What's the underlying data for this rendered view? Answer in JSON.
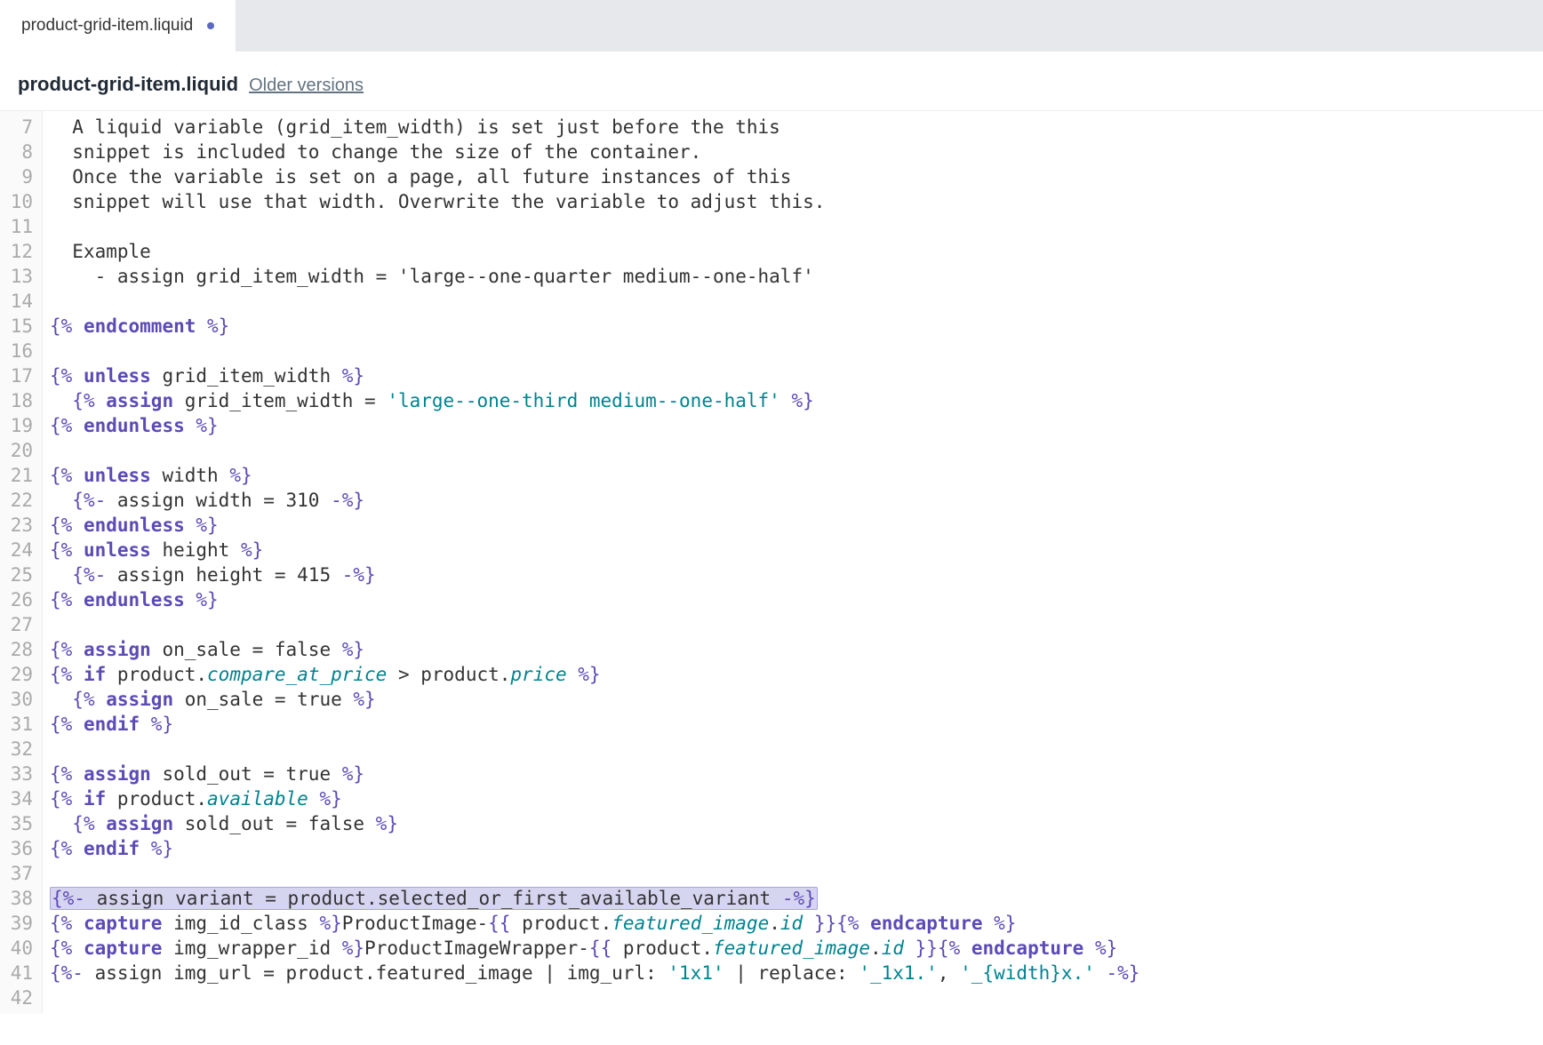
{
  "tab": {
    "label": "product-grid-item.liquid"
  },
  "header": {
    "title": "product-grid-item.liquid",
    "older_versions": "Older versions"
  },
  "gutter": {
    "start": 7,
    "end": 42
  },
  "lines": [
    {
      "n": 7,
      "segs": [
        [
          "  A liquid variable (grid_item_width) is set just before the this",
          ""
        ]
      ]
    },
    {
      "n": 8,
      "segs": [
        [
          "  snippet is included to change the size of the container.",
          ""
        ]
      ]
    },
    {
      "n": 9,
      "segs": [
        [
          "  Once the variable is set on a page, all future instances of this",
          ""
        ]
      ]
    },
    {
      "n": 10,
      "segs": [
        [
          "  snippet will use that width. Overwrite the variable to adjust this.",
          ""
        ]
      ]
    },
    {
      "n": 11,
      "segs": []
    },
    {
      "n": 12,
      "segs": [
        [
          "  Example",
          ""
        ]
      ]
    },
    {
      "n": 13,
      "segs": [
        [
          "    - assign grid_item_width = 'large--one-quarter medium--one-half'",
          ""
        ]
      ]
    },
    {
      "n": 14,
      "segs": []
    },
    {
      "n": 15,
      "segs": [
        [
          "{% ",
          "tagc"
        ],
        [
          "endcomment",
          "kw"
        ],
        [
          " %}",
          "tagc"
        ]
      ]
    },
    {
      "n": 16,
      "segs": []
    },
    {
      "n": 17,
      "segs": [
        [
          "{% ",
          "tagc"
        ],
        [
          "unless",
          "kw"
        ],
        [
          " grid_item_width ",
          ""
        ],
        [
          "%}",
          "tagc"
        ]
      ]
    },
    {
      "n": 18,
      "segs": [
        [
          "  ",
          ""
        ],
        [
          "{% ",
          "tagc"
        ],
        [
          "assign",
          "kw"
        ],
        [
          " grid_item_width = ",
          ""
        ],
        [
          "'large--one-third medium--one-half'",
          "str"
        ],
        [
          " %}",
          "tagc"
        ]
      ]
    },
    {
      "n": 19,
      "segs": [
        [
          "{% ",
          "tagc"
        ],
        [
          "endunless",
          "kw"
        ],
        [
          " %}",
          "tagc"
        ]
      ]
    },
    {
      "n": 20,
      "segs": []
    },
    {
      "n": 21,
      "segs": [
        [
          "{% ",
          "tagc"
        ],
        [
          "unless",
          "kw"
        ],
        [
          " width ",
          ""
        ],
        [
          "%}",
          "tagc"
        ]
      ]
    },
    {
      "n": 22,
      "segs": [
        [
          "  ",
          ""
        ],
        [
          "{%-",
          "tagc"
        ],
        [
          " assign width = 310 ",
          ""
        ],
        [
          "-%}",
          "tagc"
        ]
      ]
    },
    {
      "n": 23,
      "segs": [
        [
          "{% ",
          "tagc"
        ],
        [
          "endunless",
          "kw"
        ],
        [
          " %}",
          "tagc"
        ]
      ]
    },
    {
      "n": 24,
      "segs": [
        [
          "{% ",
          "tagc"
        ],
        [
          "unless",
          "kw"
        ],
        [
          " height ",
          ""
        ],
        [
          "%}",
          "tagc"
        ]
      ]
    },
    {
      "n": 25,
      "segs": [
        [
          "  ",
          ""
        ],
        [
          "{%-",
          "tagc"
        ],
        [
          " assign height = 415 ",
          ""
        ],
        [
          "-%}",
          "tagc"
        ]
      ]
    },
    {
      "n": 26,
      "segs": [
        [
          "{% ",
          "tagc"
        ],
        [
          "endunless",
          "kw"
        ],
        [
          " %}",
          "tagc"
        ]
      ]
    },
    {
      "n": 27,
      "segs": []
    },
    {
      "n": 28,
      "segs": [
        [
          "{% ",
          "tagc"
        ],
        [
          "assign",
          "kw"
        ],
        [
          " on_sale = false ",
          ""
        ],
        [
          "%}",
          "tagc"
        ]
      ]
    },
    {
      "n": 29,
      "segs": [
        [
          "{% ",
          "tagc"
        ],
        [
          "if",
          "kw"
        ],
        [
          " product.",
          ""
        ],
        [
          "compare_at_price",
          "prop"
        ],
        [
          " > product.",
          ""
        ],
        [
          "price",
          "prop"
        ],
        [
          " %}",
          "tagc"
        ]
      ]
    },
    {
      "n": 30,
      "segs": [
        [
          "  ",
          ""
        ],
        [
          "{% ",
          "tagc"
        ],
        [
          "assign",
          "kw"
        ],
        [
          " on_sale = true ",
          ""
        ],
        [
          "%}",
          "tagc"
        ]
      ]
    },
    {
      "n": 31,
      "segs": [
        [
          "{% ",
          "tagc"
        ],
        [
          "endif",
          "kw"
        ],
        [
          " %}",
          "tagc"
        ]
      ]
    },
    {
      "n": 32,
      "segs": []
    },
    {
      "n": 33,
      "segs": [
        [
          "{% ",
          "tagc"
        ],
        [
          "assign",
          "kw"
        ],
        [
          " sold_out = true ",
          ""
        ],
        [
          "%}",
          "tagc"
        ]
      ]
    },
    {
      "n": 34,
      "segs": [
        [
          "{% ",
          "tagc"
        ],
        [
          "if",
          "kw"
        ],
        [
          " product.",
          ""
        ],
        [
          "available",
          "prop"
        ],
        [
          " %}",
          "tagc"
        ]
      ]
    },
    {
      "n": 35,
      "segs": [
        [
          "  ",
          ""
        ],
        [
          "{% ",
          "tagc"
        ],
        [
          "assign",
          "kw"
        ],
        [
          " sold_out = false ",
          ""
        ],
        [
          "%}",
          "tagc"
        ]
      ]
    },
    {
      "n": 36,
      "segs": [
        [
          "{% ",
          "tagc"
        ],
        [
          "endif",
          "kw"
        ],
        [
          " %}",
          "tagc"
        ]
      ]
    },
    {
      "n": 37,
      "segs": []
    },
    {
      "n": 38,
      "hl": true,
      "segs": [
        [
          "{%-",
          "tagc"
        ],
        [
          " assign variant = product.selected_or_first_available_variant ",
          ""
        ],
        [
          "-%}",
          "tagc"
        ]
      ]
    },
    {
      "n": 39,
      "segs": [
        [
          "{% ",
          "tagc"
        ],
        [
          "capture",
          "kw"
        ],
        [
          " img_id_class ",
          ""
        ],
        [
          "%}",
          "tagc"
        ],
        [
          "ProductImage-",
          ""
        ],
        [
          "{{",
          "tagc"
        ],
        [
          " product.",
          ""
        ],
        [
          "featured_image",
          "prop"
        ],
        [
          ".",
          ""
        ],
        [
          "id",
          "prop"
        ],
        [
          " }}",
          "tagc"
        ],
        [
          "{% ",
          "tagc"
        ],
        [
          "endcapture",
          "kw"
        ],
        [
          " %}",
          "tagc"
        ]
      ]
    },
    {
      "n": 40,
      "segs": [
        [
          "{% ",
          "tagc"
        ],
        [
          "capture",
          "kw"
        ],
        [
          " img_wrapper_id ",
          ""
        ],
        [
          "%}",
          "tagc"
        ],
        [
          "ProductImageWrapper-",
          ""
        ],
        [
          "{{",
          "tagc"
        ],
        [
          " product.",
          ""
        ],
        [
          "featured_image",
          "prop"
        ],
        [
          ".",
          ""
        ],
        [
          "id",
          "prop"
        ],
        [
          " }}",
          "tagc"
        ],
        [
          "{% ",
          "tagc"
        ],
        [
          "endcapture",
          "kw"
        ],
        [
          " %}",
          "tagc"
        ]
      ]
    },
    {
      "n": 41,
      "segs": [
        [
          "{%-",
          "tagc"
        ],
        [
          " assign img_url = product.featured_image | img_url: ",
          ""
        ],
        [
          "'1x1'",
          "str"
        ],
        [
          " | replace: ",
          ""
        ],
        [
          "'_1x1.'",
          "str"
        ],
        [
          ", ",
          ""
        ],
        [
          "'_{width}x.'",
          "str"
        ],
        [
          " -%}",
          "tagc"
        ]
      ]
    },
    {
      "n": 42,
      "segs": []
    }
  ]
}
